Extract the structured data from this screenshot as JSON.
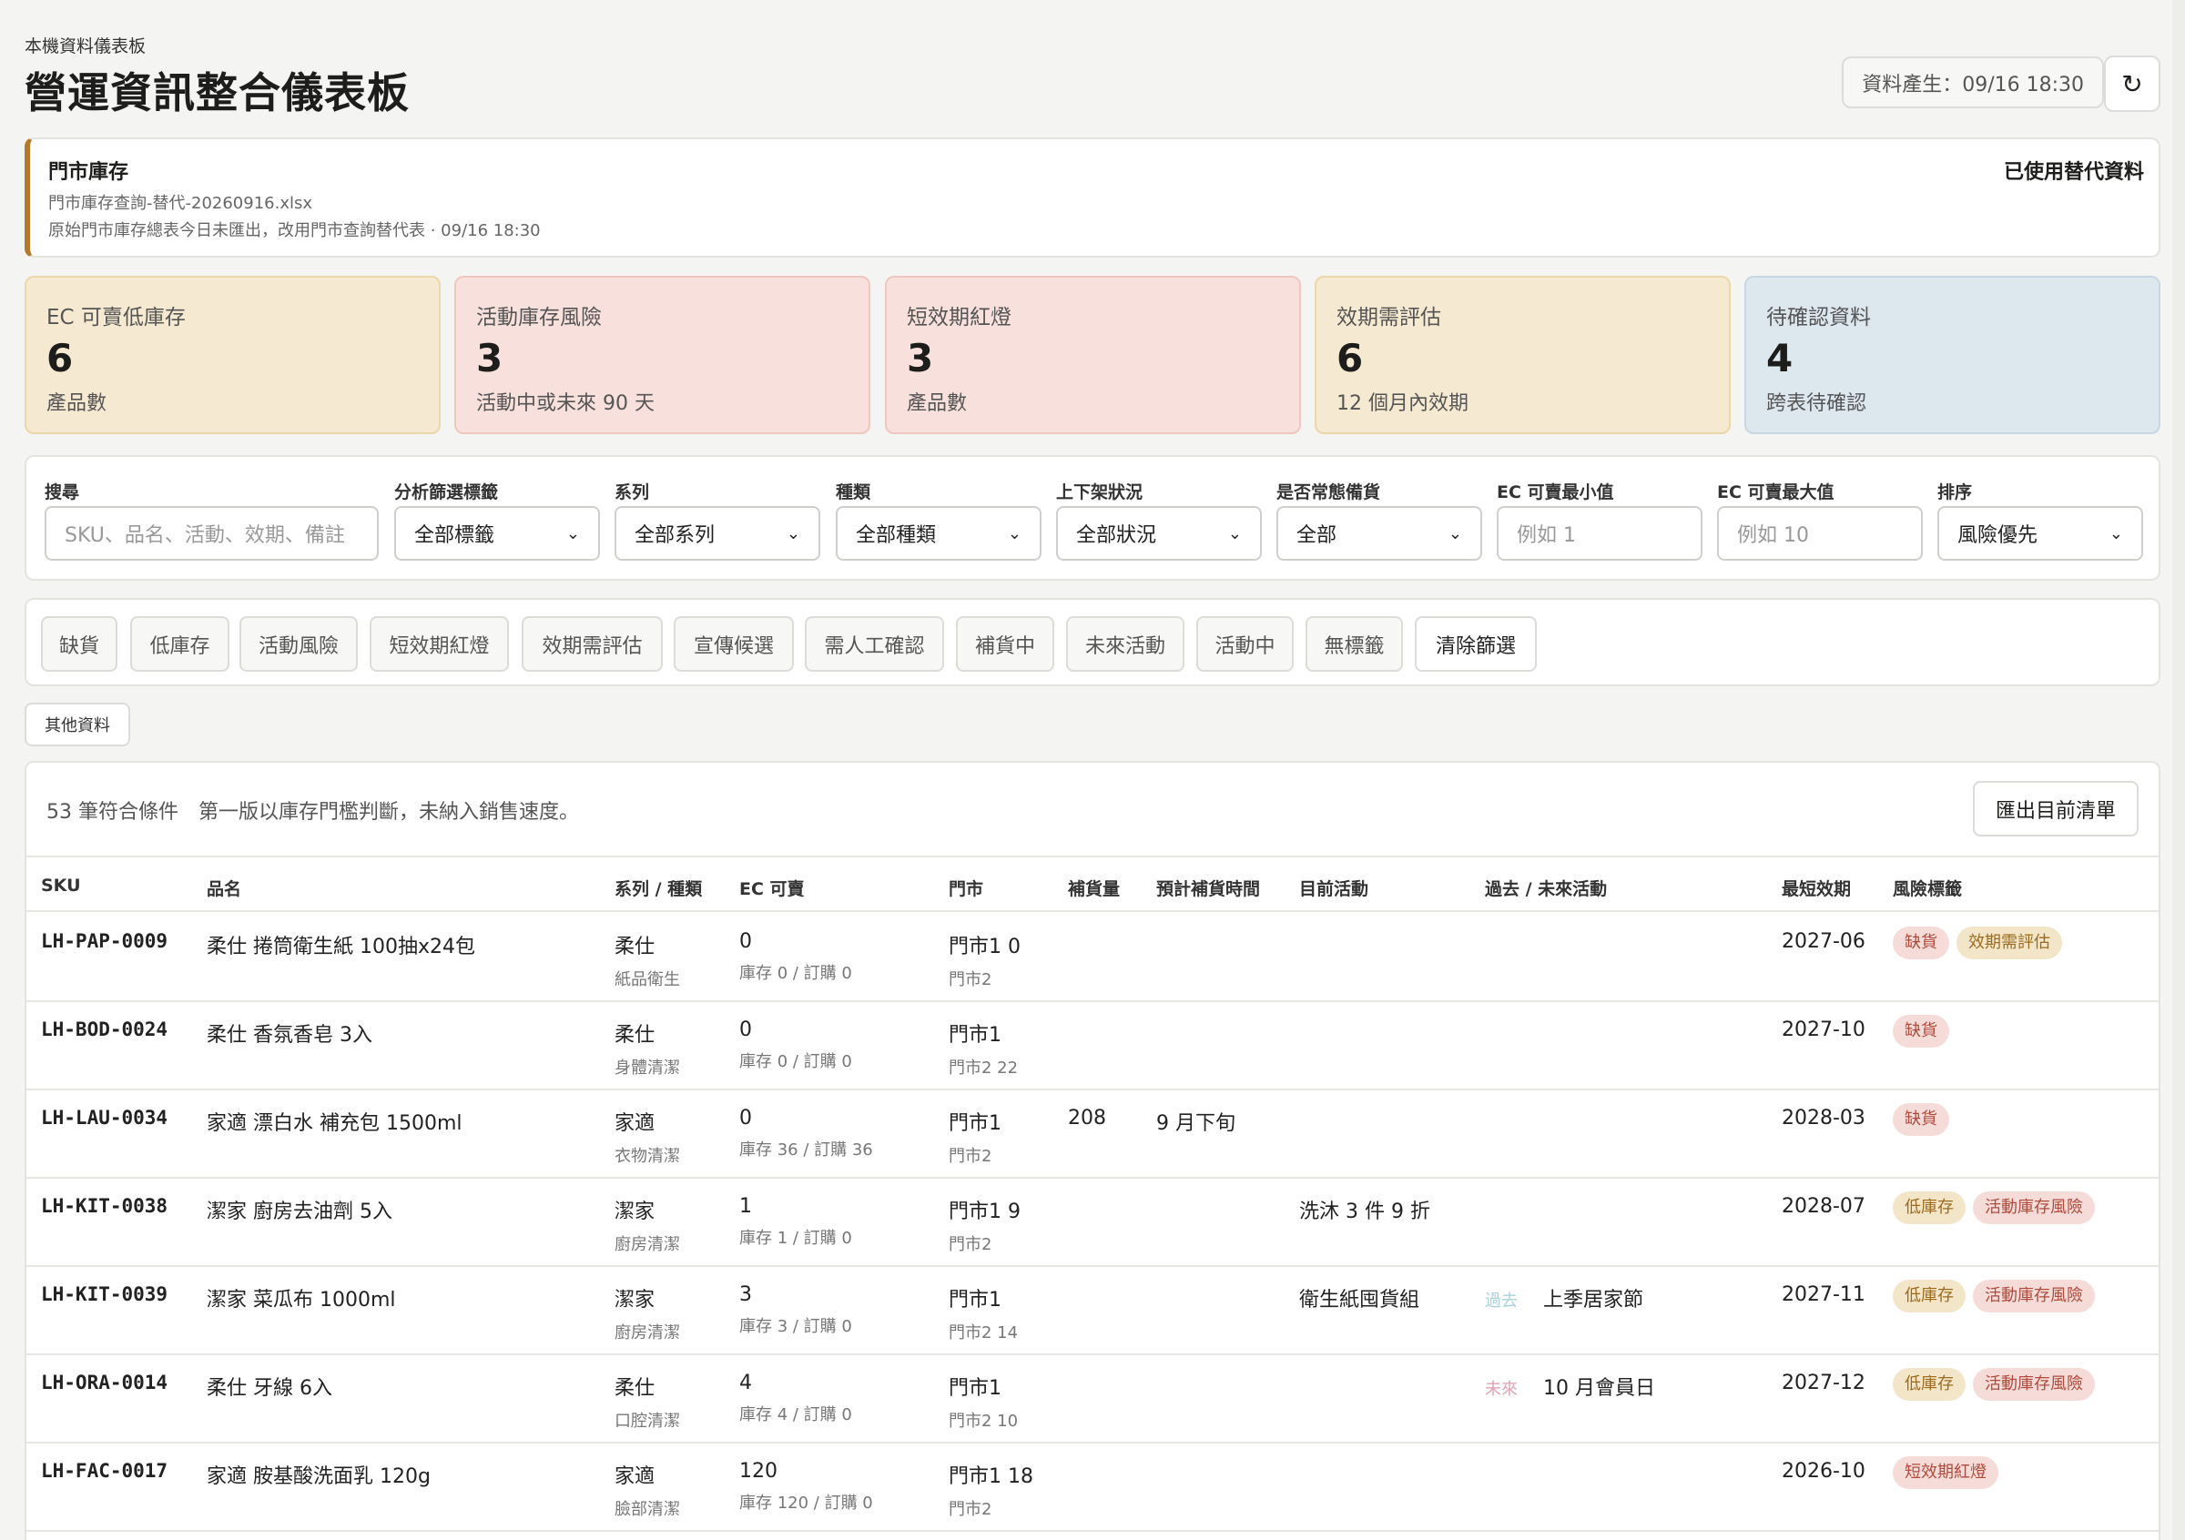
{
  "header": {
    "eyebrow": "本機資料儀表板",
    "title": "營運資訊整合儀表板",
    "generated": "資料產生：09/16 18:30",
    "refresh_icon": "↻"
  },
  "notice": {
    "title": "門市庫存",
    "file": "門市庫存查詢-替代-20260916.xlsx",
    "description": "原始門市庫存總表今日未匯出，改用門市查詢替代表 · 09/16 18:30",
    "status": "已使用替代資料"
  },
  "kpis": [
    {
      "label": "EC 可賣低庫存",
      "value": "6",
      "sub": "產品數",
      "tone": "amber"
    },
    {
      "label": "活動庫存風險",
      "value": "3",
      "sub": "活動中或未來 90 天",
      "tone": "red"
    },
    {
      "label": "短效期紅燈",
      "value": "3",
      "sub": "產品數",
      "tone": "red"
    },
    {
      "label": "效期需評估",
      "value": "6",
      "sub": "12 個月內效期",
      "tone": "amber"
    },
    {
      "label": "待確認資料",
      "value": "4",
      "sub": "跨表待確認",
      "tone": "blue"
    }
  ],
  "filters": {
    "search": {
      "label": "搜尋",
      "placeholder": "SKU、品名、活動、效期、備註"
    },
    "tag": {
      "label": "分析篩選標籤",
      "value": "全部標籤"
    },
    "series": {
      "label": "系列",
      "value": "全部系列"
    },
    "category": {
      "label": "種類",
      "value": "全部種類"
    },
    "listing": {
      "label": "上下架狀況",
      "value": "全部狀況"
    },
    "regular": {
      "label": "是否常態備貨",
      "value": "全部"
    },
    "ec_min": {
      "label": "EC 可賣最小值",
      "placeholder": "例如 1"
    },
    "ec_max": {
      "label": "EC 可賣最大值",
      "placeholder": "例如 10"
    },
    "sort": {
      "label": "排序",
      "value": "風險優先"
    }
  },
  "chips": [
    "缺貨",
    "低庫存",
    "活動風險",
    "短效期紅燈",
    "效期需評估",
    "宣傳候選",
    "需人工確認",
    "補貨中",
    "未來活動",
    "活動中",
    "無標籤",
    "清除篩選"
  ],
  "other_button": "其他資料",
  "table": {
    "summary": "53 筆符合條件　第一版以庫存門檻判斷，未納入銷售速度。",
    "export_label": "匯出目前清單",
    "columns": [
      "SKU",
      "品名",
      "系列 / 種類",
      "EC 可賣",
      "門市",
      "補貨量",
      "預計補貨時間",
      "目前活動",
      "過去 / 未來活動",
      "最短效期",
      "風險標籤"
    ],
    "rows": [
      {
        "sku": "LH-PAP-0009",
        "name": "柔仕 捲筒衛生紙 100抽x24包",
        "series": "柔仕",
        "category": "紙品衛生",
        "ec": "0",
        "stock": "庫存 0 / 訂購 0",
        "store1": "門市1 0",
        "store2": "門市2",
        "restock_qty": "",
        "restock_time": "",
        "current_event": "",
        "event_kind": "",
        "event_name": "",
        "expiry": "2027-06",
        "tags": [
          {
            "text": "缺貨",
            "tone": "red"
          },
          {
            "text": "效期需評估",
            "tone": "amber"
          }
        ]
      },
      {
        "sku": "LH-BOD-0024",
        "name": "柔仕 香氛香皂 3入",
        "series": "柔仕",
        "category": "身體清潔",
        "ec": "0",
        "stock": "庫存 0 / 訂購 0",
        "store1": "門市1",
        "store2": "門市2 22",
        "restock_qty": "",
        "restock_time": "",
        "current_event": "",
        "event_kind": "",
        "event_name": "",
        "expiry": "2027-10",
        "tags": [
          {
            "text": "缺貨",
            "tone": "red"
          }
        ]
      },
      {
        "sku": "LH-LAU-0034",
        "name": "家適 漂白水 補充包 1500ml",
        "series": "家適",
        "category": "衣物清潔",
        "ec": "0",
        "stock": "庫存 36 / 訂購 36",
        "store1": "門市1",
        "store2": "門市2",
        "restock_qty": "208",
        "restock_time": "9 月下旬",
        "current_event": "",
        "event_kind": "",
        "event_name": "",
        "expiry": "2028-03",
        "tags": [
          {
            "text": "缺貨",
            "tone": "red"
          }
        ]
      },
      {
        "sku": "LH-KIT-0038",
        "name": "潔家 廚房去油劑 5入",
        "series": "潔家",
        "category": "廚房清潔",
        "ec": "1",
        "stock": "庫存 1 / 訂購 0",
        "store1": "門市1 9",
        "store2": "門市2",
        "restock_qty": "",
        "restock_time": "",
        "current_event": "洗沐 3 件 9 折",
        "event_kind": "",
        "event_name": "",
        "expiry": "2028-07",
        "tags": [
          {
            "text": "低庫存",
            "tone": "amber"
          },
          {
            "text": "活動庫存風險",
            "tone": "red"
          }
        ]
      },
      {
        "sku": "LH-KIT-0039",
        "name": "潔家 菜瓜布 1000ml",
        "series": "潔家",
        "category": "廚房清潔",
        "ec": "3",
        "stock": "庫存 3 / 訂購 0",
        "store1": "門市1",
        "store2": "門市2 14",
        "restock_qty": "",
        "restock_time": "",
        "current_event": "衛生紙囤貨組",
        "event_kind": "過去",
        "event_name": "上季居家節",
        "expiry": "2027-11",
        "tags": [
          {
            "text": "低庫存",
            "tone": "amber"
          },
          {
            "text": "活動庫存風險",
            "tone": "red"
          }
        ]
      },
      {
        "sku": "LH-ORA-0014",
        "name": "柔仕 牙線 6入",
        "series": "柔仕",
        "category": "口腔清潔",
        "ec": "4",
        "stock": "庫存 4 / 訂購 0",
        "store1": "門市1",
        "store2": "門市2 10",
        "restock_qty": "",
        "restock_time": "",
        "current_event": "",
        "event_kind": "未來",
        "event_name": "10 月會員日",
        "expiry": "2027-12",
        "tags": [
          {
            "text": "低庫存",
            "tone": "amber"
          },
          {
            "text": "活動庫存風險",
            "tone": "red"
          }
        ]
      },
      {
        "sku": "LH-FAC-0017",
        "name": "家適 胺基酸洗面乳 120g",
        "series": "家適",
        "category": "臉部清潔",
        "ec": "120",
        "stock": "庫存 120 / 訂購 0",
        "store1": "門市1 18",
        "store2": "門市2",
        "restock_qty": "",
        "restock_time": "",
        "current_event": "",
        "event_kind": "",
        "event_name": "",
        "expiry": "2026-10",
        "tags": [
          {
            "text": "短效期紅燈",
            "tone": "red"
          }
        ]
      }
    ]
  },
  "colors": {
    "amber_card": "#f6e9d1",
    "red_card": "#f8e0dc",
    "blue_card": "#dde7ee",
    "notice_accent": "#b5792a",
    "tag_red_text": "#b24a3c",
    "tag_amber_text": "#9b6a20"
  }
}
